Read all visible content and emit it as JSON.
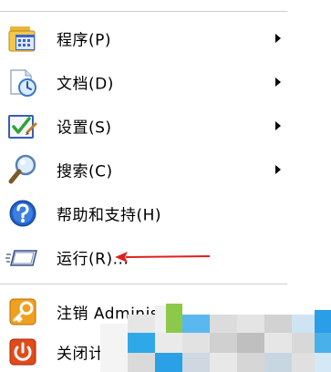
{
  "menu": {
    "items": [
      {
        "label": "程序(P)",
        "icon": "programs-icon",
        "submenu": true
      },
      {
        "label": "文档(D)",
        "icon": "documents-icon",
        "submenu": true
      },
      {
        "label": "设置(S)",
        "icon": "settings-icon",
        "submenu": true
      },
      {
        "label": "搜索(C)",
        "icon": "search-icon",
        "submenu": true
      },
      {
        "label": "帮助和支持(H)",
        "icon": "help-icon",
        "submenu": false
      },
      {
        "label": "运行(R)...",
        "icon": "run-icon",
        "submenu": false
      },
      {
        "label": "注销 Administ",
        "icon": "logoff-icon",
        "submenu": false
      },
      {
        "label": "关闭计算机",
        "icon": "shutdown-icon",
        "submenu": false
      }
    ]
  },
  "annotation": {
    "arrow_color": "#e0201c",
    "points_to": "运行(R)..."
  },
  "colors": {
    "background": "#ffffff",
    "separator": "#c9cfd8",
    "text": "#000000"
  }
}
